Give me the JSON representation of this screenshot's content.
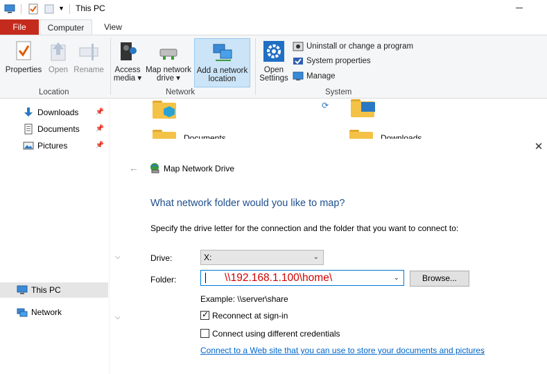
{
  "window": {
    "title": "This PC"
  },
  "tabs": {
    "file": "File",
    "computer": "Computer",
    "view": "View"
  },
  "ribbon": {
    "location": {
      "label": "Location",
      "properties": "Properties",
      "open": "Open",
      "rename": "Rename"
    },
    "network": {
      "label": "Network",
      "access_media_1": "Access",
      "access_media_2": "media ▾",
      "map_drive_1": "Map network",
      "map_drive_2": "drive ▾",
      "add_location_1": "Add a network",
      "add_location_2": "location"
    },
    "system": {
      "label": "System",
      "open_settings_1": "Open",
      "open_settings_2": "Settings",
      "uninstall": "Uninstall or change a program",
      "system_properties": "System properties",
      "manage": "Manage"
    }
  },
  "nav": {
    "items": [
      {
        "label": "Downloads"
      },
      {
        "label": "Documents"
      },
      {
        "label": "Pictures"
      },
      {
        "label": "This PC"
      },
      {
        "label": "Network"
      }
    ]
  },
  "content": {
    "folders": [
      {
        "label": "Documents"
      },
      {
        "label": "Downloads"
      }
    ]
  },
  "dialog": {
    "title": "Map Network Drive",
    "heading": "What network folder would you like to map?",
    "instruction": "Specify the drive letter for the connection and the folder that you want to connect to:",
    "drive_label": "Drive:",
    "drive_value": "X:",
    "folder_label": "Folder:",
    "folder_value": "\\\\192.168.1.100\\home\\",
    "browse_label": "Browse...",
    "example": "Example: \\\\server\\share",
    "reconnect_label": "Reconnect at sign-in",
    "reconnect_checked": true,
    "different_credentials_label": "Connect using different credentials",
    "different_credentials_checked": false,
    "link_text": "Connect to a Web site that you can use to store your documents and pictures",
    "link_suffix": "."
  },
  "colors": {
    "file_tab": "#c42b1c",
    "heading": "#1f4e8c",
    "link": "#0066cc",
    "folder_value": "#d00000",
    "selected_ribbon": "#cce4f7"
  }
}
